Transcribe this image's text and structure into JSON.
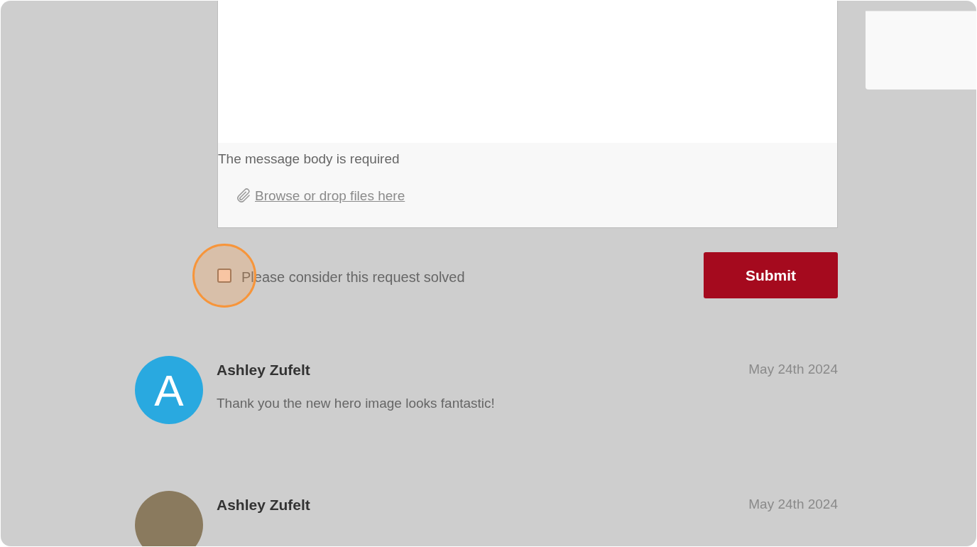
{
  "editor": {
    "error": "The message body is required",
    "attach_link": "Browse or drop files here"
  },
  "solved_checkbox": {
    "label": "Please consider this request solved",
    "checked": false,
    "highlighted": true
  },
  "submit_button": "Submit",
  "comments": [
    {
      "author": "Ashley Zufelt",
      "date": "May 24th 2024",
      "text": "Thank you the new hero image looks fantastic!",
      "avatar": {
        "kind": "letter",
        "letter": "A"
      }
    },
    {
      "author": "Ashley Zufelt",
      "date": "May 24th 2024",
      "avatar": {
        "kind": "photo"
      }
    }
  ]
}
